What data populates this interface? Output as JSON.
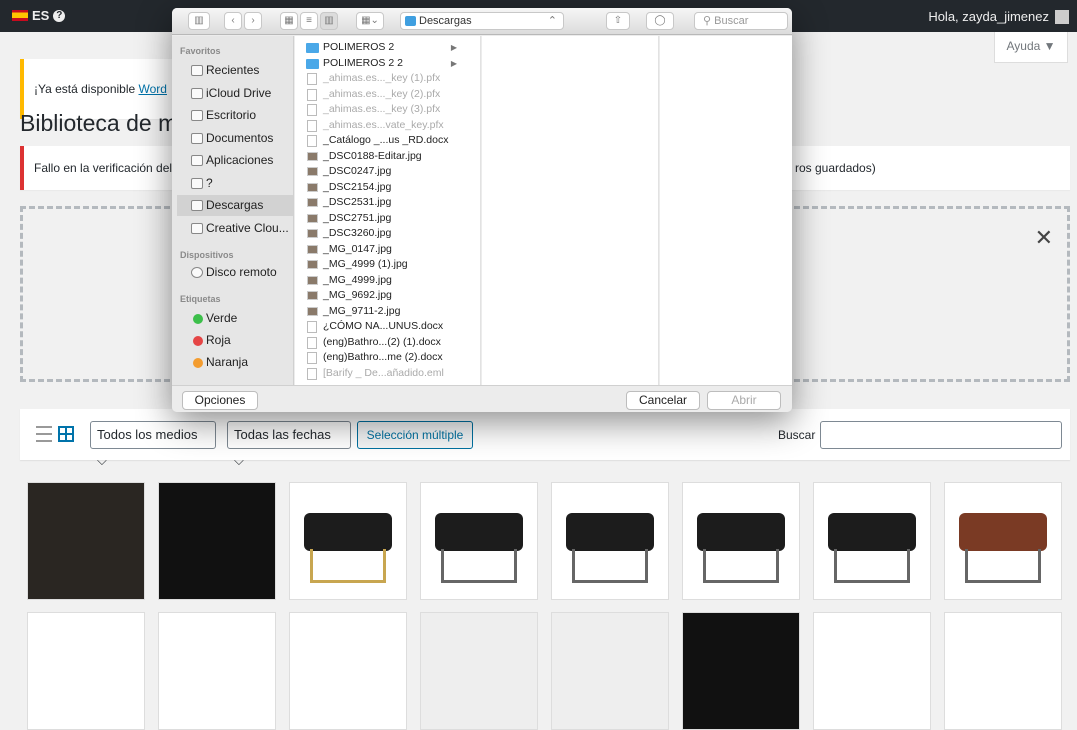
{
  "adminbar": {
    "lang": "ES",
    "howdy": "Hola, zayda_jimenez"
  },
  "help": "Ayuda ▼",
  "update_notice": {
    "text": "¡Ya está disponible ",
    "link": "Word"
  },
  "title": "Biblioteca de med",
  "error_notice": {
    "text": "Fallo en la verificación del",
    "tail": "ros guardados)"
  },
  "dropzone_close": "✕",
  "toolbar": {
    "filter_media": "Todos los medios ⌵",
    "filter_dates": "Todas las fechas ⌵",
    "bulk": "Selección múltiple",
    "search_label": "Buscar"
  },
  "dialog": {
    "location": "Descargas",
    "search": "Buscar",
    "sidebar": {
      "favorites": "Favoritos",
      "devices": "Dispositivos",
      "tags": "Etiquetas",
      "fav_items": [
        "Recientes",
        "iCloud Drive",
        "Escritorio",
        "Documentos",
        "Aplicaciones",
        "?",
        "Descargas",
        "Creative Clou..."
      ],
      "device_items": [
        "Disco remoto"
      ],
      "tag_items": [
        {
          "label": "Verde",
          "color": "#3cbf4a"
        },
        {
          "label": "Roja",
          "color": "#e54545"
        },
        {
          "label": "Naranja",
          "color": "#f39c2f"
        }
      ]
    },
    "files": [
      {
        "name": "POLIMEROS 2",
        "kind": "folder",
        "dim": false
      },
      {
        "name": "POLIMEROS 2 2",
        "kind": "folder",
        "dim": false
      },
      {
        "name": "_ahimas.es..._key (1).pfx",
        "kind": "file",
        "dim": true
      },
      {
        "name": "_ahimas.es..._key (2).pfx",
        "kind": "file",
        "dim": true
      },
      {
        "name": "_ahimas.es..._key (3).pfx",
        "kind": "file",
        "dim": true
      },
      {
        "name": "_ahimas.es...vate_key.pfx",
        "kind": "file",
        "dim": true
      },
      {
        "name": "_Catálogo _...us _RD.docx",
        "kind": "file",
        "dim": false
      },
      {
        "name": "_DSC0188-Editar.jpg",
        "kind": "img",
        "dim": false
      },
      {
        "name": "_DSC0247.jpg",
        "kind": "img",
        "dim": false
      },
      {
        "name": "_DSC2154.jpg",
        "kind": "img",
        "dim": false
      },
      {
        "name": "_DSC2531.jpg",
        "kind": "img",
        "dim": false
      },
      {
        "name": "_DSC2751.jpg",
        "kind": "img",
        "dim": false
      },
      {
        "name": "_DSC3260.jpg",
        "kind": "img",
        "dim": false
      },
      {
        "name": "_MG_0147.jpg",
        "kind": "img",
        "dim": false
      },
      {
        "name": "_MG_4999 (1).jpg",
        "kind": "img",
        "dim": false
      },
      {
        "name": "_MG_4999.jpg",
        "kind": "img",
        "dim": false
      },
      {
        "name": "_MG_9692.jpg",
        "kind": "img",
        "dim": false
      },
      {
        "name": "_MG_9711-2.jpg",
        "kind": "img",
        "dim": false
      },
      {
        "name": "¿CÓMO NA...UNUS.docx",
        "kind": "file",
        "dim": false
      },
      {
        "name": "(eng)Bathro...(2) (1).docx",
        "kind": "file",
        "dim": false
      },
      {
        "name": "(eng)Bathro...me (2).docx",
        "kind": "file",
        "dim": false
      },
      {
        "name": "[Barify _ De...añadido.eml",
        "kind": "file",
        "dim": true
      }
    ],
    "options": "Opciones",
    "cancel": "Cancelar",
    "open": "Abrir"
  },
  "thumb_colors": [
    "#2a2622",
    "#111",
    "#fff",
    "#fff",
    "#fff",
    "#fff",
    "#fff",
    "#fff"
  ]
}
